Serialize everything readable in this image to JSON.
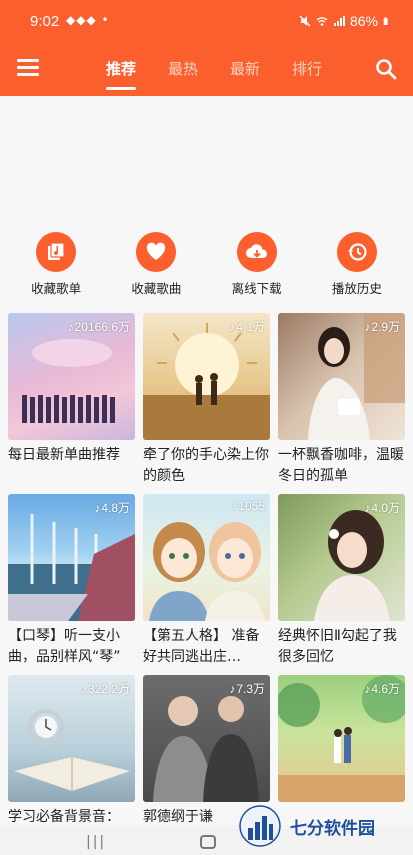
{
  "status_bar": {
    "time": "9:02",
    "notifications": "◆◆◆ •",
    "battery": "86%"
  },
  "appbar": {
    "tabs": [
      {
        "label": "推荐",
        "active": true
      },
      {
        "label": "最热",
        "active": false
      },
      {
        "label": "最新",
        "active": false
      },
      {
        "label": "排行",
        "active": false
      }
    ]
  },
  "actions": [
    {
      "label": "收藏歌单",
      "icon": "playlist-icon"
    },
    {
      "label": "收藏歌曲",
      "icon": "heart-icon"
    },
    {
      "label": "离线下载",
      "icon": "cloud-download-icon"
    },
    {
      "label": "播放历史",
      "icon": "history-icon"
    }
  ],
  "playlists": [
    {
      "title": "每日最新单曲推荐",
      "plays": "20166.6万"
    },
    {
      "title": "牵了你的手心染上你的颜色",
      "plays": "4.1万"
    },
    {
      "title": "一杯飘香咖啡，温暖冬日的孤单",
      "plays": "2.9万"
    },
    {
      "title": "【口琴】听一支小曲，品别样风“琴”",
      "plays": "4.8万"
    },
    {
      "title": "【第五人格】  准备好共同逃出庄…",
      "plays": "1055"
    },
    {
      "title": "经典怀旧Ⅱ勾起了我很多回忆",
      "plays": "4.0万"
    },
    {
      "title": "学习必备背景音：",
      "plays": "322.2万"
    },
    {
      "title": "郭德纲于谦",
      "plays": "7.3万"
    },
    {
      "title": "",
      "plays": "4.6万"
    }
  ],
  "watermark": {
    "text": "七分软件园"
  },
  "colors": {
    "accent": "#fb5f2e",
    "watermark": "#1d4f9c"
  }
}
